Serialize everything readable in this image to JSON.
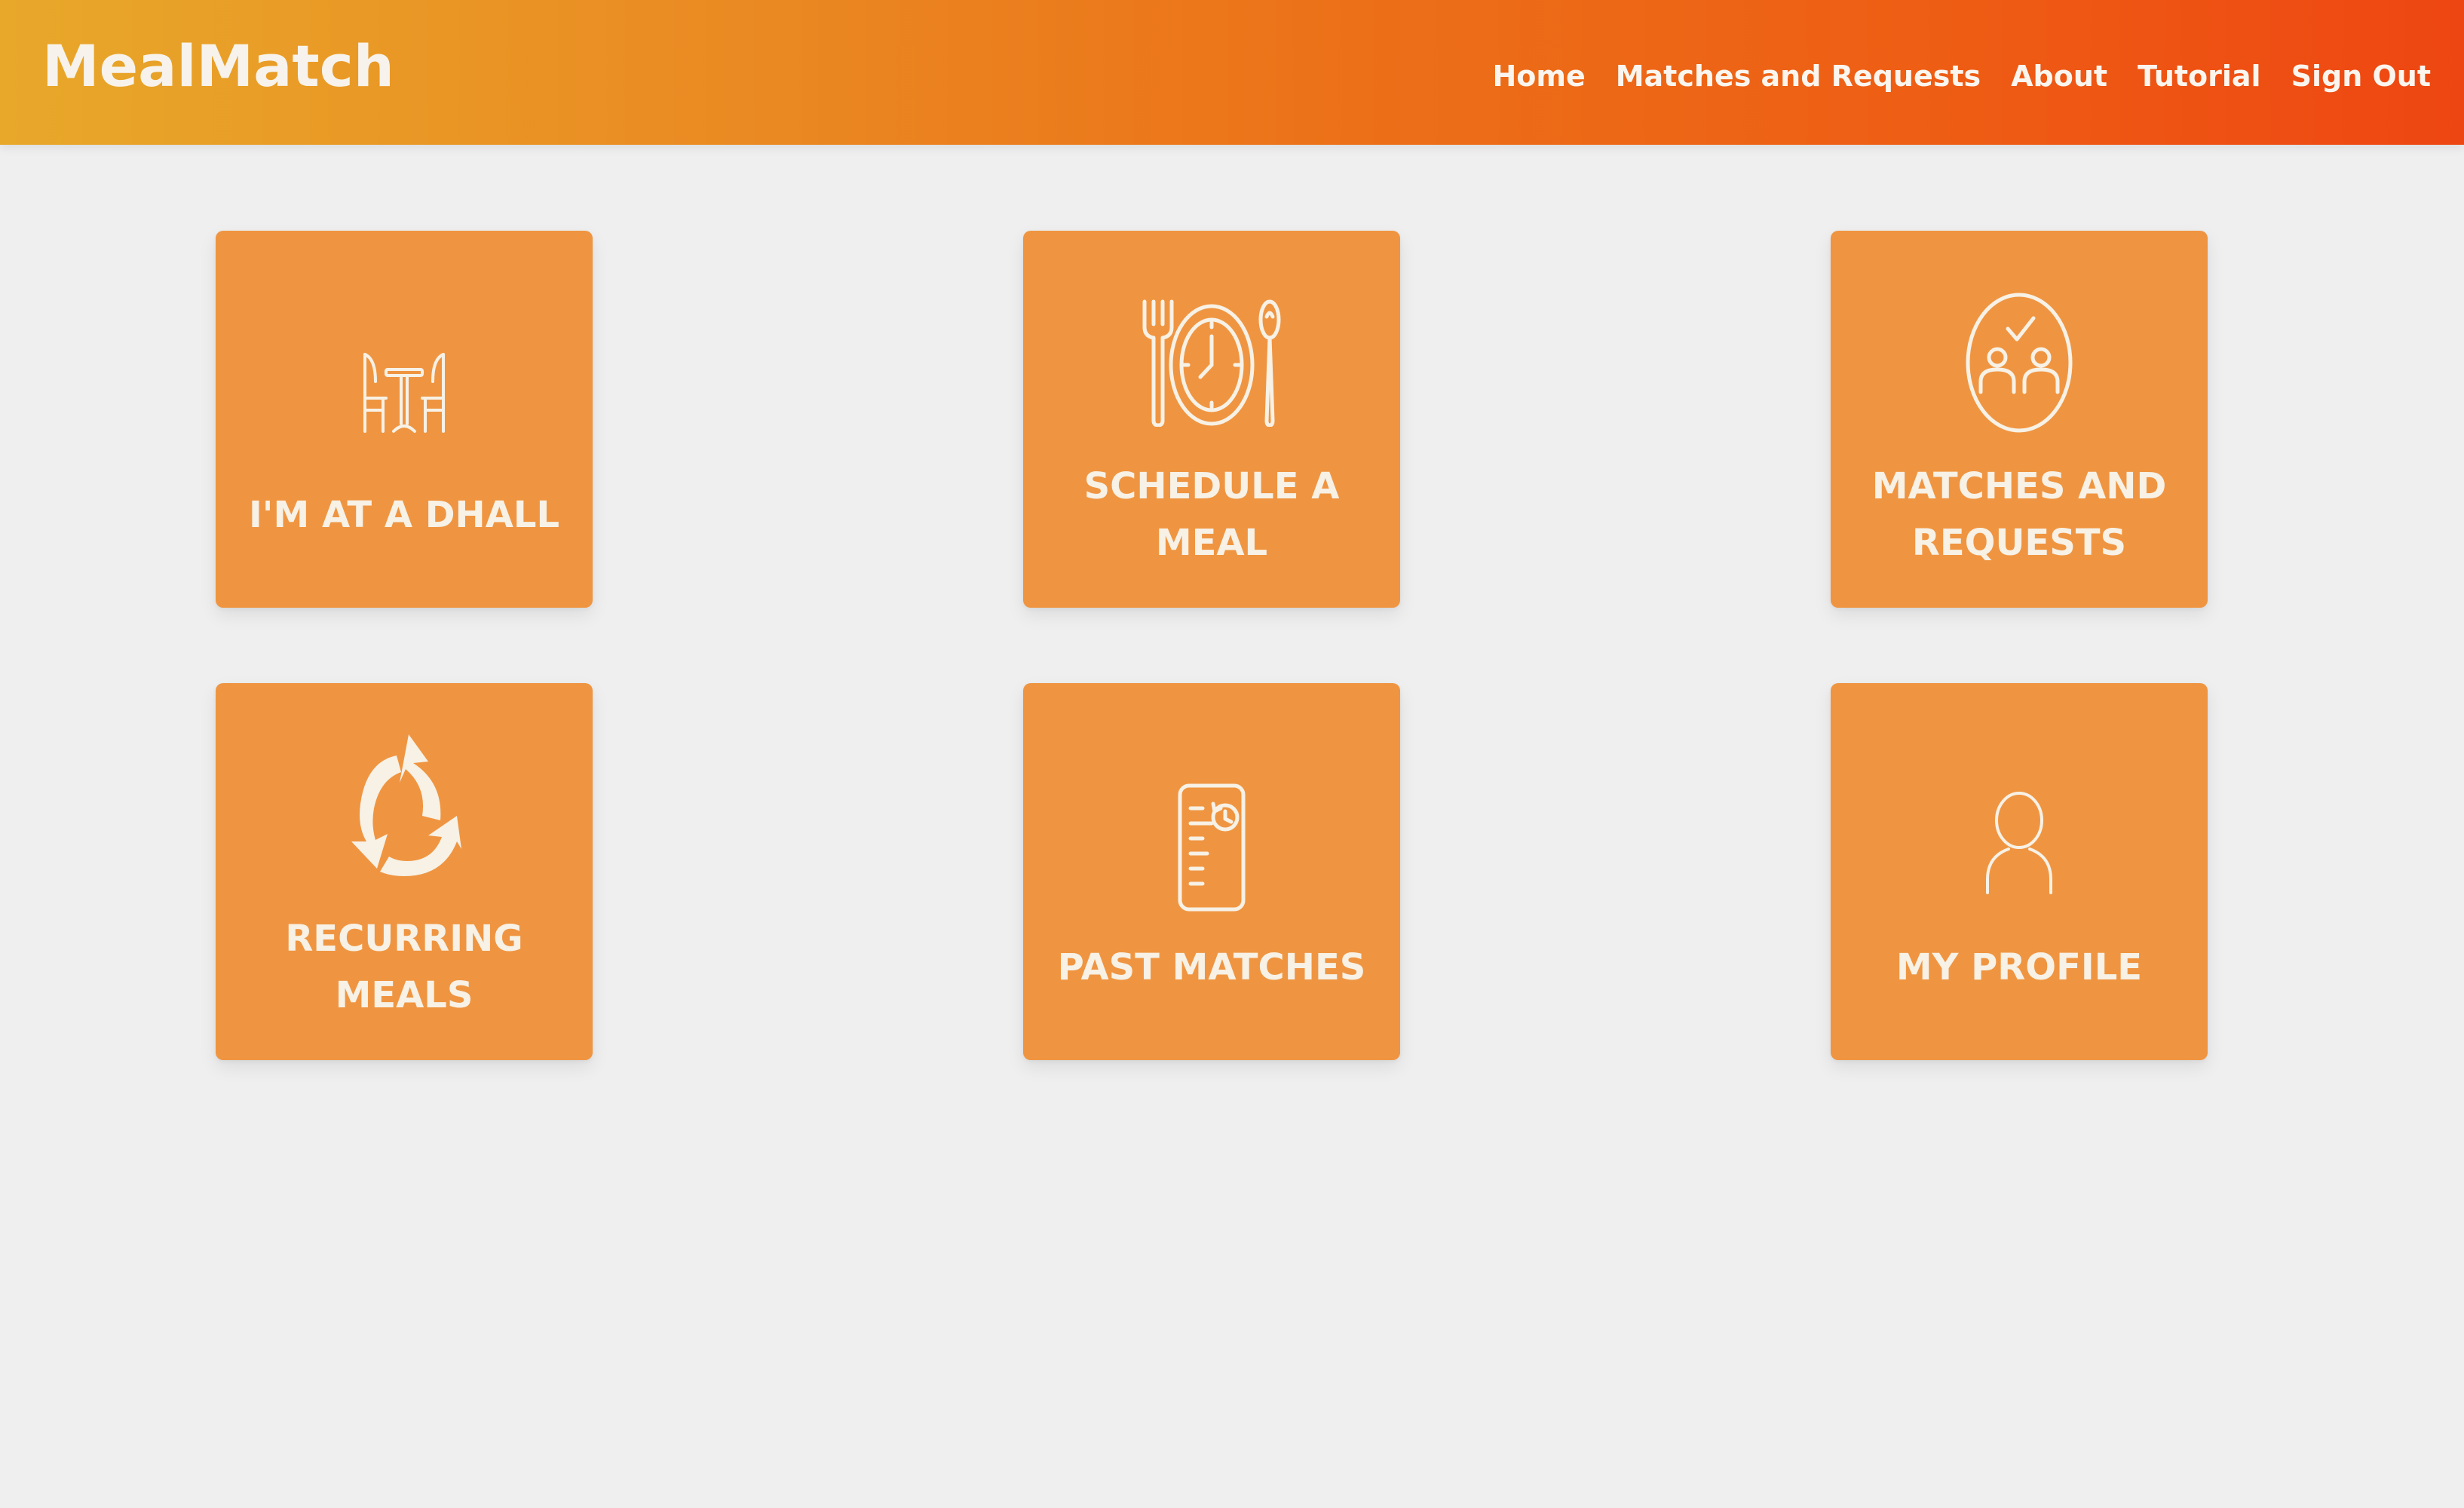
{
  "app": {
    "brand": "MealMatch"
  },
  "nav": {
    "items": [
      {
        "label": "Home",
        "icon": ""
      },
      {
        "label": "Matches and Requests",
        "icon": ""
      },
      {
        "label": "About",
        "icon": ""
      },
      {
        "label": "Tutorial",
        "icon": ""
      },
      {
        "label": "Sign Out",
        "icon": ""
      }
    ]
  },
  "tiles": [
    {
      "label": "I'M AT A DHALL",
      "icon": "dining-table-icon"
    },
    {
      "label": "SCHEDULE A MEAL",
      "icon": "plate-clock-icon"
    },
    {
      "label": "MATCHES AND REQUESTS",
      "icon": "people-check-icon"
    },
    {
      "label": "RECURRING MEALS",
      "icon": "recycle-arrows-icon"
    },
    {
      "label": "PAST MATCHES",
      "icon": "history-list-icon"
    },
    {
      "label": "MY PROFILE",
      "icon": "person-icon"
    }
  ],
  "colors": {
    "tile": "#ef9541",
    "header_start": "#e8a82a",
    "header_end": "#ee4612",
    "background": "#efefef",
    "text_light": "#f7f1e6"
  }
}
